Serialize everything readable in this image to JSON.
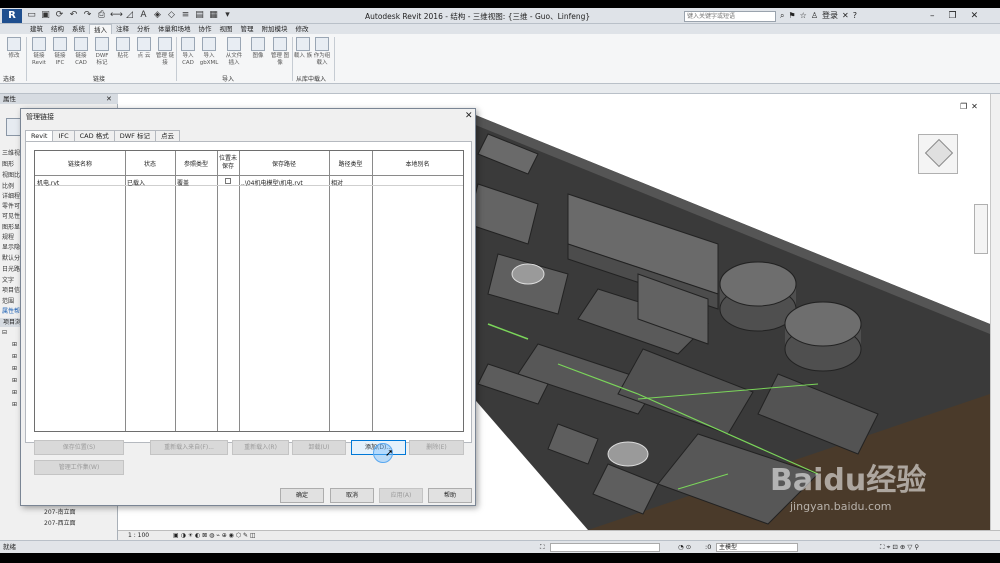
{
  "app": {
    "logo": "R",
    "title": "Autodesk Revit 2016 -   结构 - 三维视图: {三维 - Guo、Linfeng}",
    "search_placeholder": "键入关键字或短语",
    "user": "登录"
  },
  "ribbon": {
    "tabs": [
      "建筑",
      "结构",
      "系统",
      "插入",
      "注释",
      "分析",
      "体量和场地",
      "协作",
      "视图",
      "管理",
      "附加模块",
      "修改"
    ],
    "active_tab": "插入",
    "buttons": [
      {
        "label": "修改"
      },
      {
        "label": "链接 Revit"
      },
      {
        "label": "链接 IFC"
      },
      {
        "label": "链接 CAD"
      },
      {
        "label": "DWF 标记"
      },
      {
        "label": "贴花"
      },
      {
        "label": "点 云"
      },
      {
        "label": "管理 链接"
      },
      {
        "label": "导入 CAD"
      },
      {
        "label": "导入 gbXML"
      },
      {
        "label": "从文件 插入"
      },
      {
        "label": "图像"
      },
      {
        "label": "管理 图像"
      },
      {
        "label": "载入 族"
      },
      {
        "label": "作为组 载入"
      }
    ],
    "panels": [
      "选择",
      "链接",
      "导入",
      "从库中载入"
    ]
  },
  "left": {
    "props_title": "属性",
    "rows": [
      "三维视",
      "图形",
      "视图比",
      "比例",
      "详细程",
      "零件可",
      "可见性",
      "图形显",
      "规程",
      "显示隐",
      "默认分",
      "日光路",
      "文字",
      "项目信",
      "范围",
      "属性帮"
    ],
    "browser_title": "项目浏",
    "elevations": [
      "207-南立面",
      "207-西立面"
    ]
  },
  "dialog": {
    "title": "管理链接",
    "tabs": [
      "Revit",
      "IFC",
      "CAD 格式",
      "DWF 标记",
      "点云"
    ],
    "active_tab": "Revit",
    "columns": [
      "链接名称",
      "状态",
      "参照类型",
      "位置未保存",
      "保存路径",
      "路径类型",
      "本地别名"
    ],
    "rows": [
      {
        "name": "机电.rvt",
        "status": "已载入",
        "ref_type": "覆盖",
        "pos_unsaved": false,
        "path": "..\\04机电模型\\机电.rvt",
        "path_type": "相对",
        "alias": ""
      }
    ],
    "buttons": {
      "save_position": "保存位置(S)",
      "reload_from": "重新载入来自(F)...",
      "reload": "重新载入(R)",
      "unload": "卸载(U)",
      "add": "添加(D)...",
      "remove": "删除(E)",
      "manage_worksets": "管理工作集(W)",
      "ok": "确定",
      "cancel": "取消",
      "apply": "应用(A)",
      "help": "帮助"
    }
  },
  "viewbar": {
    "scale": "1 : 100"
  },
  "status": {
    "text": "就绪",
    "model": "主模型",
    "zero": ":0"
  },
  "watermark": {
    "main": "Baidu经验",
    "sub": "jingyan.baidu.com"
  }
}
